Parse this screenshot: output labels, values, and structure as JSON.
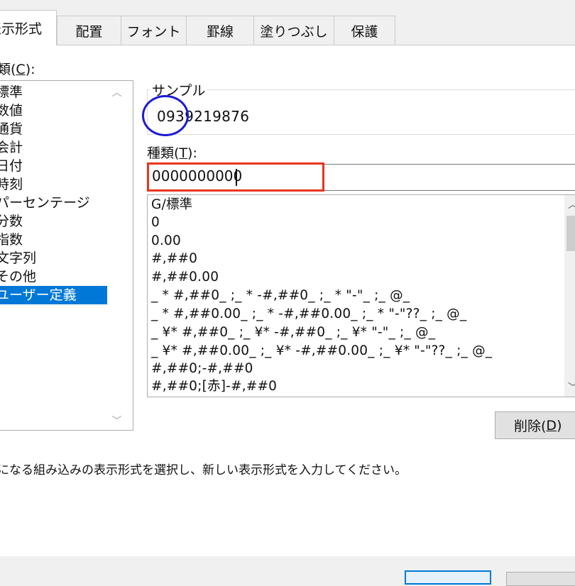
{
  "tabs": [
    {
      "label": "表示形式",
      "active": true
    },
    {
      "label": "配置"
    },
    {
      "label": "フォント"
    },
    {
      "label": "罫線"
    },
    {
      "label": "塗りつぶし"
    },
    {
      "label": "保護"
    }
  ],
  "category_label": "類(",
  "category_label_key": "C",
  "category_label_end": "):",
  "categories": [
    "標準",
    "数値",
    "通貨",
    "会計",
    "日付",
    "時刻",
    "パーセンテージ",
    "分数",
    "指数",
    "文字列",
    "その他",
    "ユーザー定義"
  ],
  "selected_category": "ユーザー定義",
  "sample": {
    "legend": "サンプル",
    "value": "0939219876"
  },
  "type_label": "種類(",
  "type_label_key": "T",
  "type_label_end": "):",
  "type_value": "0000000000",
  "formats": [
    "G/標準",
    "0",
    "0.00",
    "#,##0",
    "#,##0.00",
    "_ * #,##0_ ;_ * -#,##0_ ;_ * \"-\"_ ;_ @_",
    "_ * #,##0.00_ ;_ * -#,##0.00_ ;_ * \"-\"??_ ;_ @_",
    "_ ¥* #,##0_ ;_ ¥* -#,##0_ ;_ ¥* \"-\"_ ;_ @_",
    "_ ¥* #,##0.00_ ;_ ¥* -#,##0.00_ ;_ ¥* \"-\"??_ ;_ @_",
    "#,##0;-#,##0",
    "#,##0;[赤]-#,##0"
  ],
  "delete_button": {
    "label": "削除(",
    "key": "D",
    "end": ")"
  },
  "description": "になる組み込みの表示形式を選択し、新しい表示形式を入力してください。",
  "colors": {
    "selection": "#0078d7",
    "highlight_red": "#e8351e",
    "highlight_blue": "#1a1ad6"
  }
}
